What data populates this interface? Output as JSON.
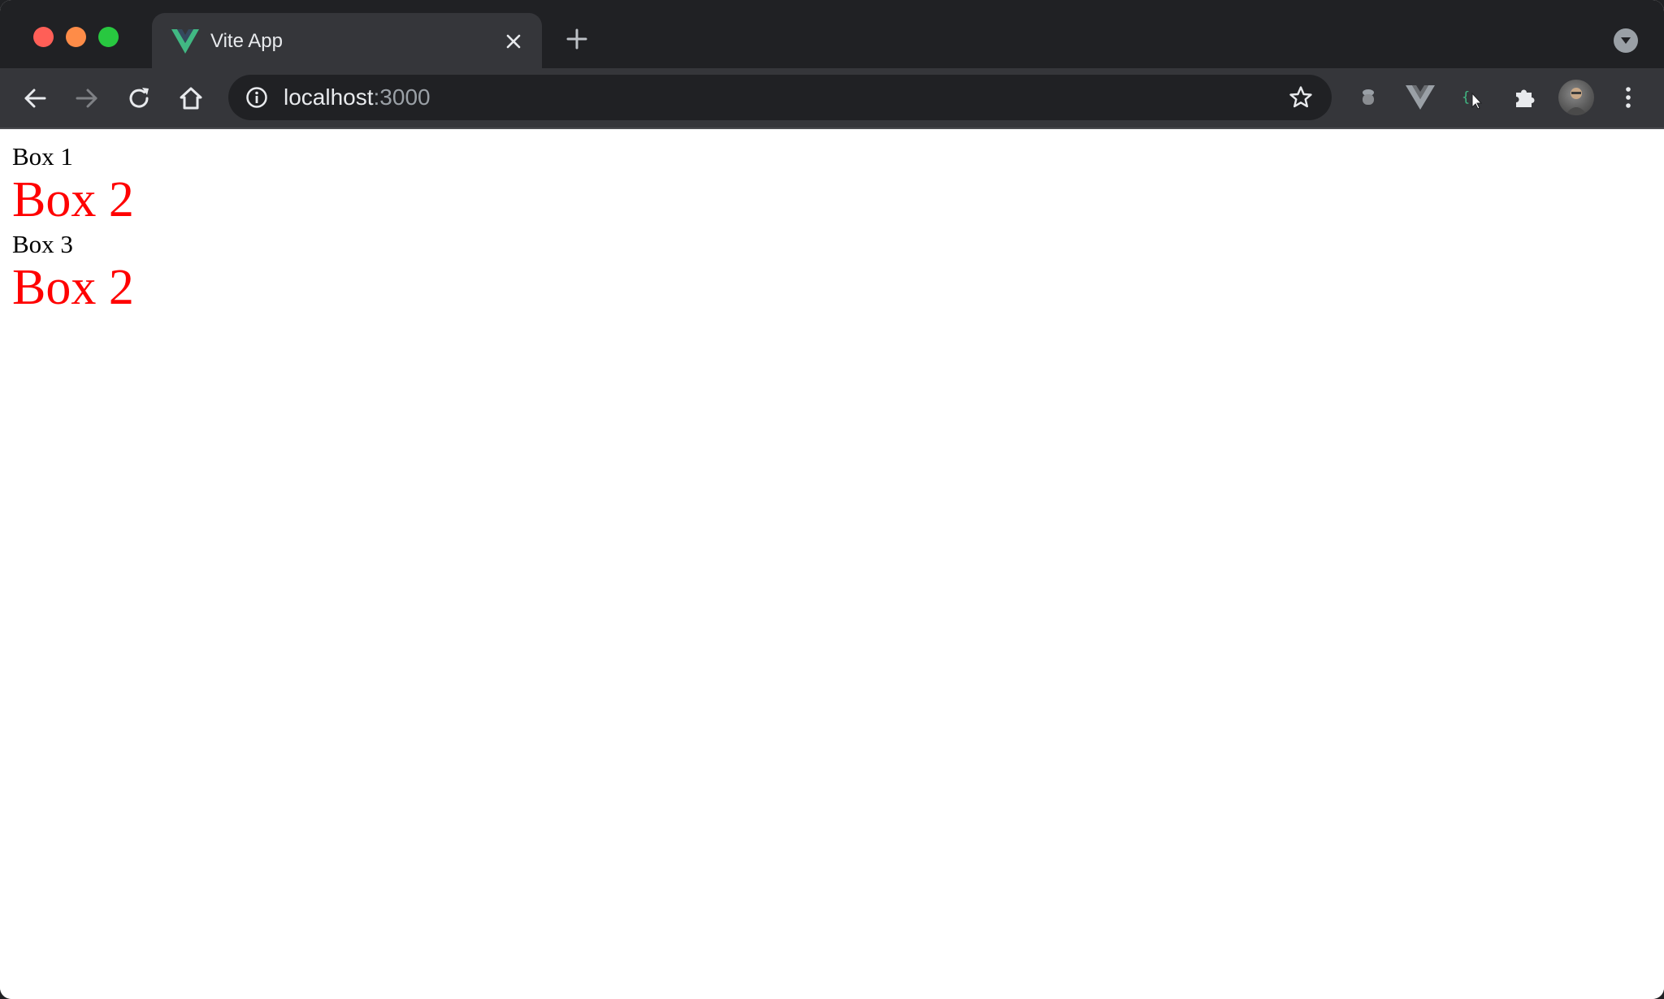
{
  "window": {
    "traffic_lights": {
      "close_color": "#ff5f57",
      "minimize_color": "#fe8c48",
      "maximize_color": "#28c840"
    }
  },
  "tab": {
    "title": "Vite App",
    "favicon": "vue-logo-icon",
    "favicon_colors": [
      "#41b883",
      "#34495e"
    ]
  },
  "toolbar": {
    "back_icon": "back-arrow-icon",
    "forward_icon": "forward-arrow-icon",
    "reload_icon": "reload-icon",
    "home_icon": "home-icon",
    "url_host": "localhost",
    "url_port": ":3000",
    "site_info_icon": "info-icon",
    "bookmark_icon": "star-icon",
    "extensions": [
      "acorn-extension-icon",
      "vue-devtools-icon",
      "devtools-inspector-icon",
      "puzzle-extensions-icon"
    ],
    "profile_icon": "avatar",
    "menu_icon": "kebab-menu-icon"
  },
  "page": {
    "boxes": [
      {
        "label": "Box 1",
        "style": "normal",
        "color": "#000000"
      },
      {
        "label": "Box 2",
        "style": "large",
        "color": "#ff0000"
      },
      {
        "label": "Box 3",
        "style": "normal",
        "color": "#000000"
      },
      {
        "label": "Box 2",
        "style": "large",
        "color": "#ff0000"
      }
    ]
  }
}
